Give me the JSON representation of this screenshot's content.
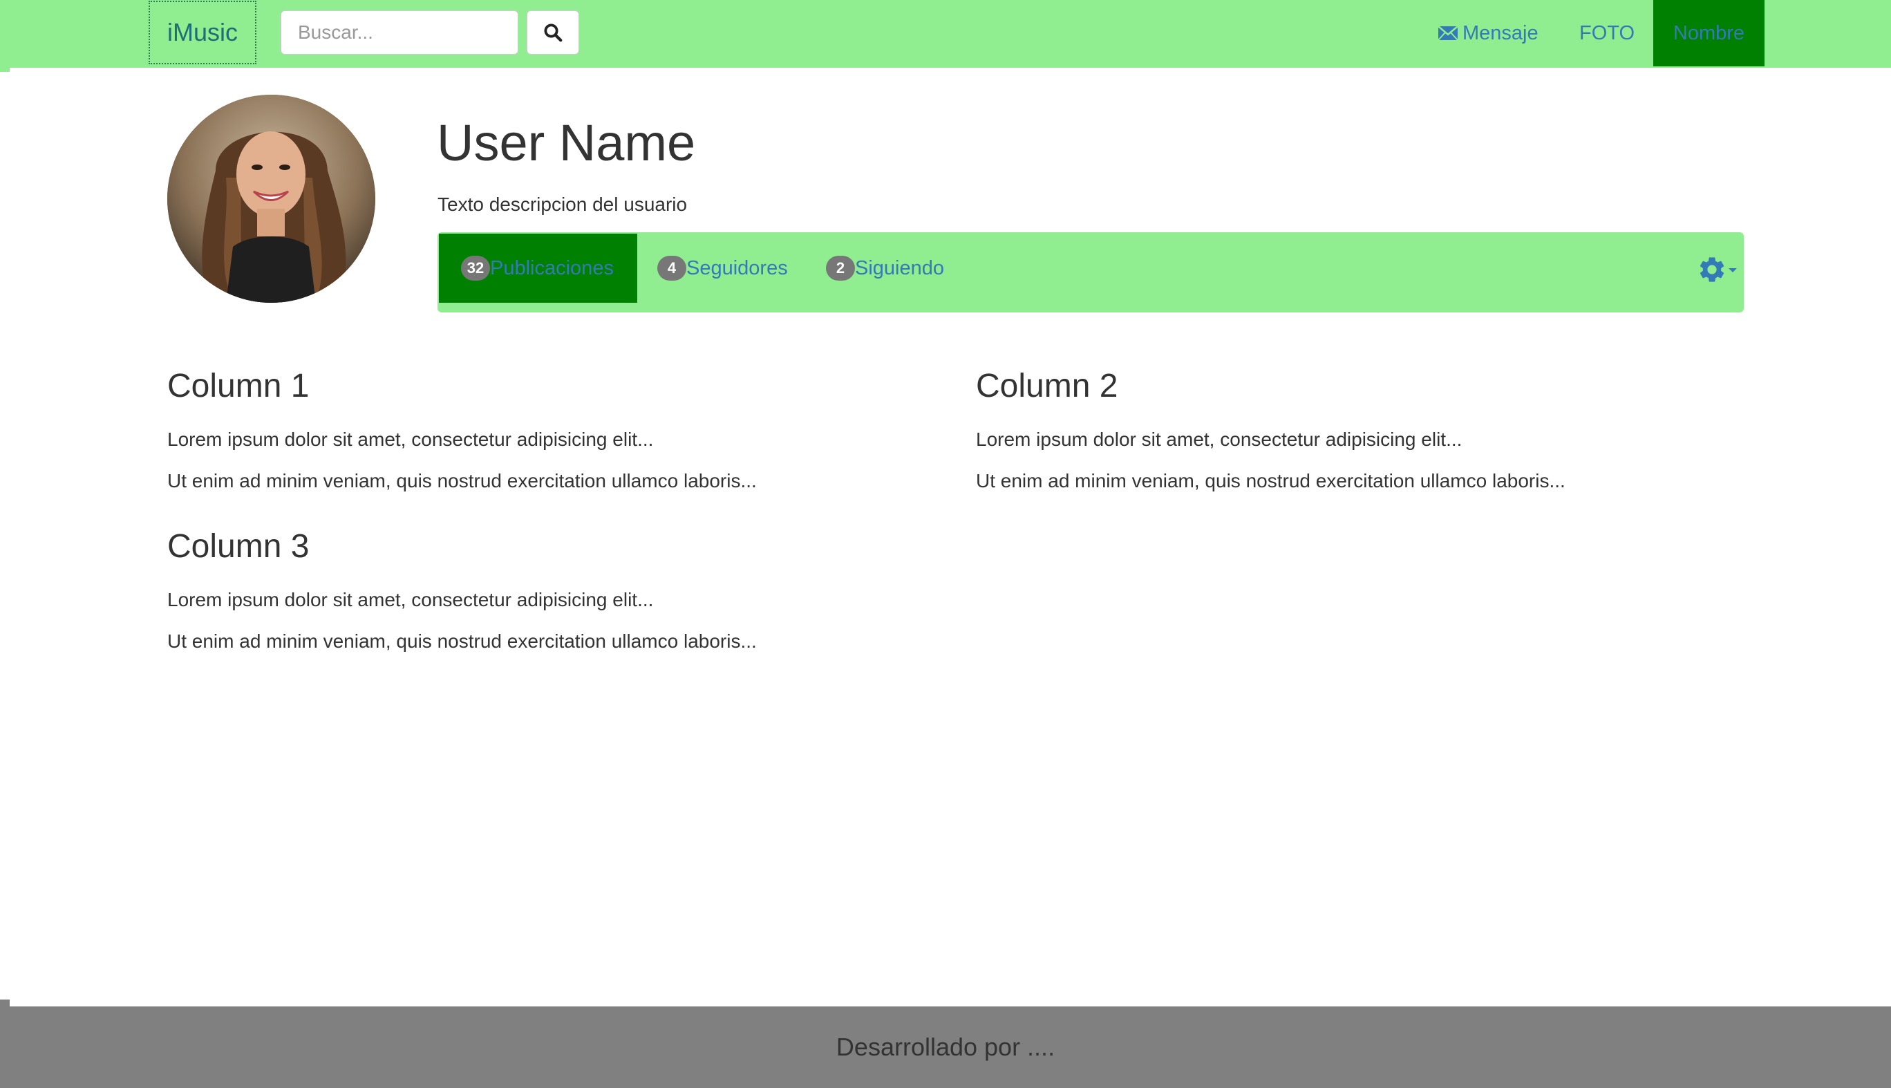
{
  "navbar": {
    "brand": "iMusic",
    "search_placeholder": "Buscar...",
    "links": {
      "message": "Mensaje",
      "foto": "FOTO",
      "nombre": "Nombre"
    },
    "colors": {
      "background": "#90ee90",
      "active": "#008000",
      "link": "#337ab7"
    }
  },
  "profile": {
    "name": "User Name",
    "description": "Texto descripcion del usuario"
  },
  "stats": [
    {
      "count": "32",
      "label": "Publicaciones",
      "active": true
    },
    {
      "count": "4",
      "label": "Seguidores",
      "active": false
    },
    {
      "count": "2",
      "label": "Siguiendo",
      "active": false
    }
  ],
  "columns": [
    {
      "title": "Column 1",
      "lines": [
        "Lorem ipsum dolor sit amet, consectetur adipisicing elit...",
        "Ut enim ad minim veniam, quis nostrud exercitation ullamco laboris..."
      ]
    },
    {
      "title": "Column 2",
      "lines": [
        "Lorem ipsum dolor sit amet, consectetur adipisicing elit...",
        "Ut enim ad minim veniam, quis nostrud exercitation ullamco laboris..."
      ]
    },
    {
      "title": "Column 3",
      "lines": [
        "Lorem ipsum dolor sit amet, consectetur adipisicing elit...",
        "Ut enim ad minim veniam, quis nostrud exercitation ullamco laboris..."
      ]
    }
  ],
  "icons": {
    "search": "search-icon",
    "message": "envelope-icon",
    "settings": "gear-icon"
  },
  "footer": {
    "text": "Desarrollado por ...."
  }
}
